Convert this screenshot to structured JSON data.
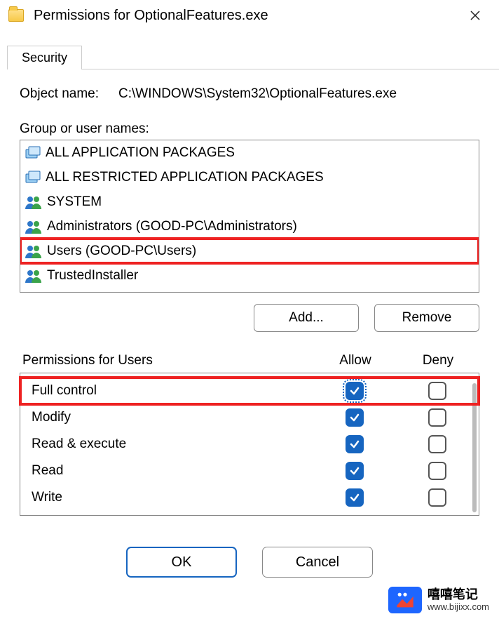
{
  "window": {
    "title": "Permissions for OptionalFeatures.exe"
  },
  "tab": {
    "security": "Security"
  },
  "object_name": {
    "label": "Object name:",
    "value": "C:\\WINDOWS\\System32\\OptionalFeatures.exe"
  },
  "group_section": {
    "label": "Group or user names:",
    "items": [
      {
        "icon": "pkg",
        "label": "ALL APPLICATION PACKAGES"
      },
      {
        "icon": "pkg",
        "label": "ALL RESTRICTED APPLICATION PACKAGES"
      },
      {
        "icon": "users",
        "label": "SYSTEM"
      },
      {
        "icon": "users",
        "label": "Administrators (GOOD-PC\\Administrators)"
      },
      {
        "icon": "users",
        "label": "Users (GOOD-PC\\Users)",
        "highlighted": true
      },
      {
        "icon": "users",
        "label": "TrustedInstaller"
      }
    ]
  },
  "buttons": {
    "add": "Add...",
    "remove": "Remove",
    "ok": "OK",
    "cancel": "Cancel"
  },
  "permissions": {
    "header_label": "Permissions for Users",
    "col_allow": "Allow",
    "col_deny": "Deny",
    "rows": [
      {
        "name": "Full control",
        "allow": true,
        "deny": false,
        "highlighted": true,
        "focused": true
      },
      {
        "name": "Modify",
        "allow": true,
        "deny": false
      },
      {
        "name": "Read & execute",
        "allow": true,
        "deny": false
      },
      {
        "name": "Read",
        "allow": true,
        "deny": false
      },
      {
        "name": "Write",
        "allow": true,
        "deny": false
      }
    ]
  },
  "watermark": {
    "title": "嘻嘻笔记",
    "url": "www.bijixx.com"
  }
}
